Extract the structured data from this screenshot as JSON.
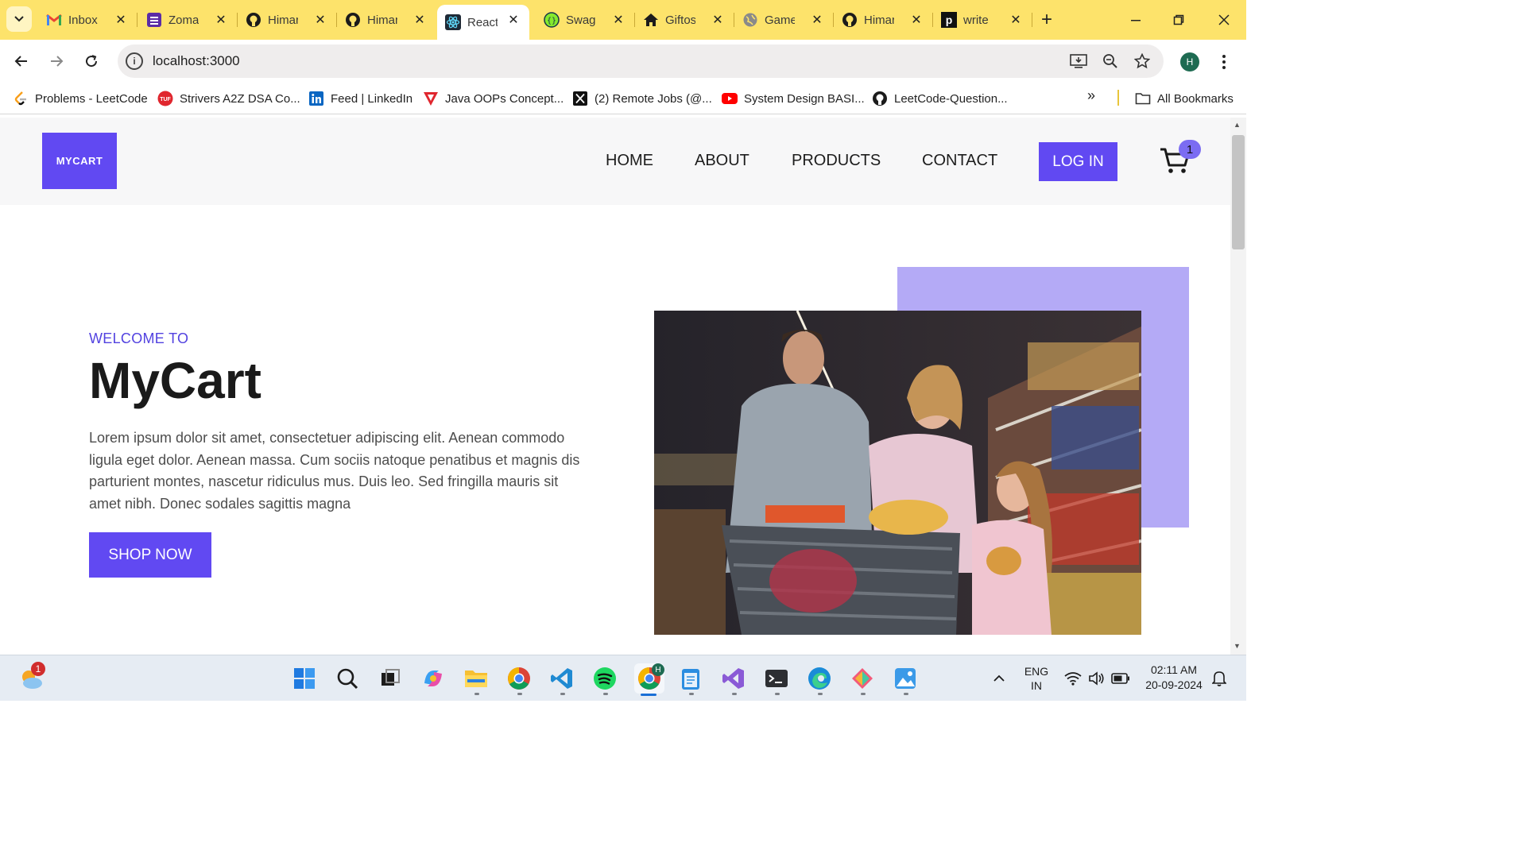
{
  "browser": {
    "tabs": [
      {
        "title": "Inbox",
        "icon": "gmail-icon",
        "active": false
      },
      {
        "title": "Zoma",
        "icon": "zomato-icon",
        "active": false
      },
      {
        "title": "Himar",
        "icon": "github-icon",
        "active": false
      },
      {
        "title": "Himar",
        "icon": "github-icon",
        "active": false
      },
      {
        "title": "React",
        "icon": "react-icon",
        "active": true
      },
      {
        "title": "Swag",
        "icon": "swagger-icon",
        "active": false
      },
      {
        "title": "Giftos",
        "icon": "home-icon",
        "active": false
      },
      {
        "title": "Game",
        "icon": "globe-icon",
        "active": false
      },
      {
        "title": "Himar",
        "icon": "github-icon",
        "active": false
      },
      {
        "title": "write",
        "icon": "p-icon",
        "active": false
      }
    ],
    "url": "localhost:3000",
    "profile_initial": "H",
    "bookmarks": [
      {
        "label": "Problems - LeetCode",
        "icon": "leetcode-icon"
      },
      {
        "label": "Strivers A2Z DSA Co...",
        "icon": "tuf-icon"
      },
      {
        "label": "Feed | LinkedIn",
        "icon": "linkedin-icon"
      },
      {
        "label": "Java OOPs Concept...",
        "icon": "javatpoint-icon"
      },
      {
        "label": "(2) Remote Jobs (@...",
        "icon": "x-icon"
      },
      {
        "label": "System Design BASI...",
        "icon": "youtube-icon"
      },
      {
        "label": "LeetCode-Question...",
        "icon": "github-icon"
      }
    ],
    "all_bookmarks": "All Bookmarks"
  },
  "site": {
    "logo": "MYCART",
    "nav": [
      "HOME",
      "ABOUT",
      "PRODUCTS",
      "CONTACT"
    ],
    "login": "LOG IN",
    "cart_count": "1",
    "hero": {
      "welcome": "WELCOME TO",
      "title": "MyCart",
      "description": "Lorem ipsum dolor sit amet, consectetuer adipiscing elit. Aenean commodo ligula eget dolor. Aenean massa. Cum sociis natoque penatibus et magnis dis parturient montes, nascetur ridiculus mus. Duis leo. Sed fringilla mauris sit amet nibh. Donec sodales sagittis magna",
      "button": "SHOP NOW"
    },
    "accent_color": "#6149f2"
  },
  "taskbar": {
    "weather_badge": "1",
    "language": "ENG",
    "region": "IN",
    "time": "02:11 AM",
    "date": "20-09-2024"
  }
}
